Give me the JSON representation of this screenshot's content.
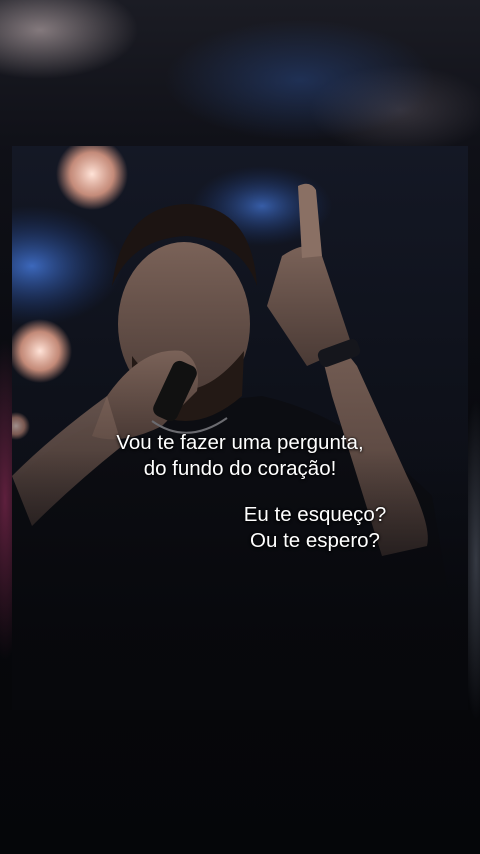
{
  "caption": {
    "line1": "Vou te fazer uma pergunta,",
    "line2": "do fundo do coração!",
    "line3": "Eu te esqueço?",
    "line4": "Ou te espero?"
  },
  "colors": {
    "background": "#07080c",
    "text": "#ffffff",
    "stage_light_blue": "#2f6fd6",
    "stage_light_pink": "#f2c2b8"
  }
}
